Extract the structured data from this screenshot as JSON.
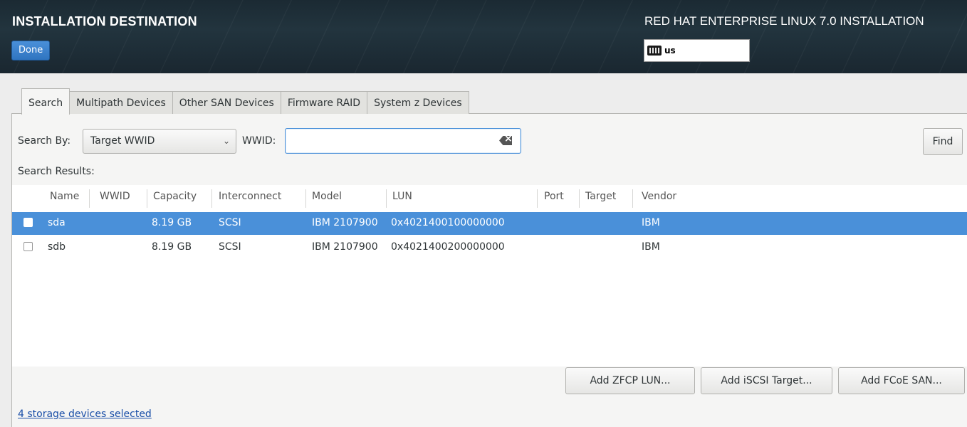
{
  "header": {
    "title": "INSTALLATION DESTINATION",
    "done_label": "Done",
    "product": "RED HAT ENTERPRISE LINUX 7.0 INSTALLATION",
    "keyboard_layout": "us"
  },
  "tabs": [
    {
      "label": "Search",
      "active": true
    },
    {
      "label": "Multipath Devices",
      "active": false
    },
    {
      "label": "Other SAN Devices",
      "active": false
    },
    {
      "label": "Firmware RAID",
      "active": false
    },
    {
      "label": "System z Devices",
      "active": false
    }
  ],
  "search": {
    "by_label": "Search By:",
    "by_value": "Target WWID",
    "wwid_label": "WWID:",
    "wwid_value": "",
    "find_label": "Find",
    "results_label": "Search Results:"
  },
  "table": {
    "columns": [
      "Name",
      "WWID",
      "Capacity",
      "Interconnect",
      "Model",
      "LUN",
      "Port",
      "Target",
      "Vendor"
    ],
    "rows": [
      {
        "selected": true,
        "checked": false,
        "name": "sda",
        "wwid": "",
        "capacity": "8.19 GB",
        "interconnect": "SCSI",
        "model": "IBM 2107900",
        "lun": "0x4021400100000000",
        "port": "",
        "target": "",
        "vendor": "IBM"
      },
      {
        "selected": false,
        "checked": false,
        "name": "sdb",
        "wwid": "",
        "capacity": "8.19 GB",
        "interconnect": "SCSI",
        "model": "IBM 2107900",
        "lun": "0x4021400200000000",
        "port": "",
        "target": "",
        "vendor": "IBM"
      }
    ]
  },
  "buttons": {
    "add_zfcp": "Add ZFCP LUN...",
    "add_iscsi": "Add iSCSI Target...",
    "add_fcoe": "Add FCoE SAN..."
  },
  "status": {
    "selected_link": "4 storage devices selected"
  },
  "colors": {
    "selection": "#4a90d9",
    "header_bg": "#1f2f38",
    "link": "#1a4fa8"
  }
}
